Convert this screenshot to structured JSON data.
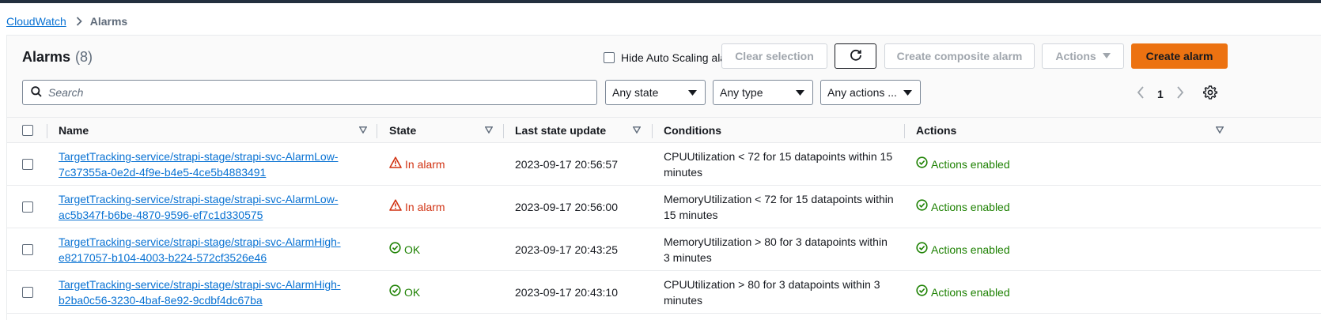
{
  "breadcrumb": {
    "root": "CloudWatch",
    "current": "Alarms"
  },
  "header": {
    "title": "Alarms",
    "count": "(8)",
    "hide_autoscaling_label": "Hide Auto Scaling alarms",
    "clear_selection": "Clear selection",
    "create_composite": "Create composite alarm",
    "actions": "Actions",
    "create_alarm": "Create alarm"
  },
  "filters": {
    "search_placeholder": "Search",
    "state": "Any state",
    "type": "Any type",
    "actions": "Any actions ..."
  },
  "pagination": {
    "page": "1"
  },
  "table": {
    "columns": [
      "Name",
      "State",
      "Last state update",
      "Conditions",
      "Actions"
    ],
    "rows": [
      {
        "name_line1": "TargetTracking-service/strapi-stage/strapi-svc-AlarmLow-",
        "name_line2": "7c37355a-0e2d-4f9e-b4e5-4ce5b4883491",
        "state": "In alarm",
        "last_update": "2023-09-17 20:56:57",
        "cond_line1": "CPUUtilization < 72 for 15 datapoints within 15",
        "cond_line2": "minutes",
        "actions": "Actions enabled"
      },
      {
        "name_line1": "TargetTracking-service/strapi-stage/strapi-svc-AlarmLow-",
        "name_line2": "ac5b347f-b6be-4870-9596-ef7c1d330575",
        "state": "In alarm",
        "last_update": "2023-09-17 20:56:00",
        "cond_line1": "MemoryUtilization < 72 for 15 datapoints within",
        "cond_line2": "15 minutes",
        "actions": "Actions enabled"
      },
      {
        "name_line1": "TargetTracking-service/strapi-stage/strapi-svc-AlarmHigh-",
        "name_line2": "e8217057-b104-4003-b224-572cf3526e46",
        "state": "OK",
        "last_update": "2023-09-17 20:43:25",
        "cond_line1": "MemoryUtilization > 80 for 3 datapoints within",
        "cond_line2": "3 minutes",
        "actions": "Actions enabled"
      },
      {
        "name_line1": "TargetTracking-service/strapi-stage/strapi-svc-AlarmHigh-",
        "name_line2": "b2ba0c56-3230-4baf-8e92-9cdbf4dc67ba",
        "state": "OK",
        "last_update": "2023-09-17 20:43:10",
        "cond_line1": "CPUUtilization > 80 for 3 datapoints within 3",
        "cond_line2": "minutes",
        "actions": "Actions enabled"
      }
    ]
  },
  "colors": {
    "accent": "#ec7211",
    "link": "#0972d3",
    "alarm": "#d13212",
    "ok": "#1d8102"
  }
}
